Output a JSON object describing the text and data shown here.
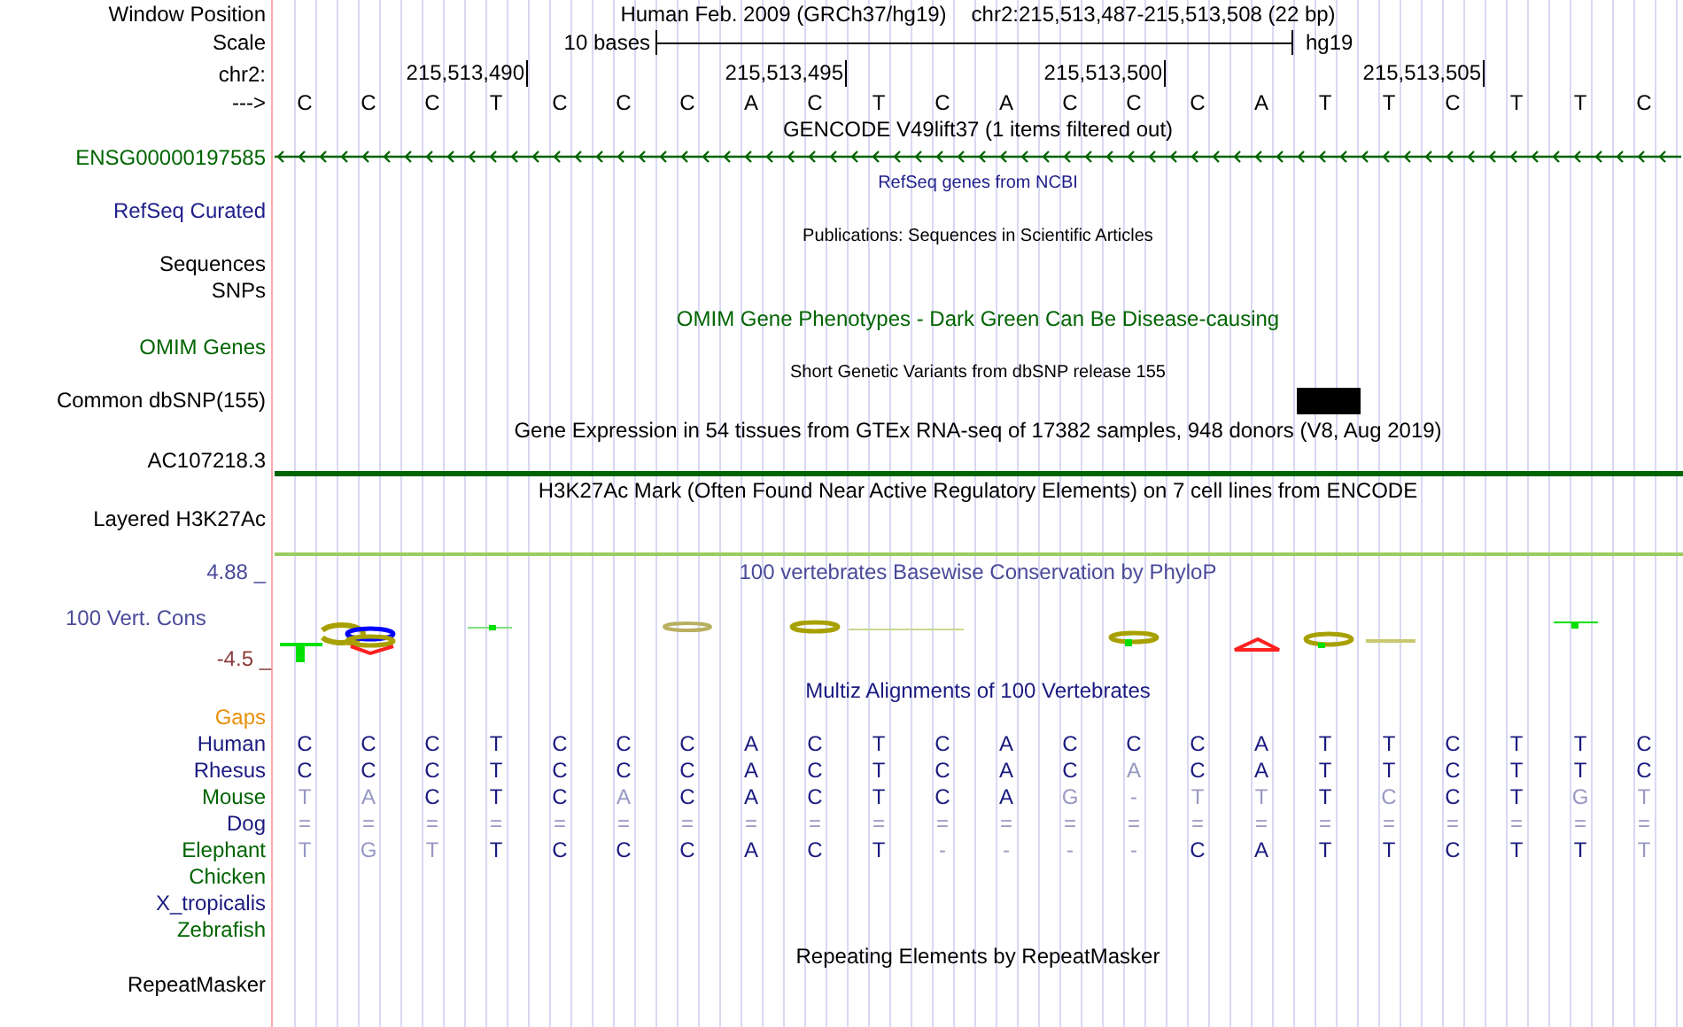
{
  "header": {
    "position_label": "Window Position",
    "assembly": "Human Feb. 2009 (GRCh37/hg19)",
    "position": "chr2:215,513,487-215,513,508 (22 bp)",
    "scale_label": "Scale",
    "scale_text": "10 bases",
    "scale_db": "hg19",
    "chrom_label": "chr2:",
    "ticks": [
      "215,513,490",
      "215,513,495",
      "215,513,500",
      "215,513,505"
    ],
    "strand_label": "--->",
    "bases": [
      "C",
      "C",
      "C",
      "T",
      "C",
      "C",
      "C",
      "A",
      "C",
      "T",
      "C",
      "A",
      "C",
      "C",
      "C",
      "A",
      "T",
      "T",
      "C",
      "T",
      "T",
      "C"
    ]
  },
  "tracks": [
    {
      "kind": "gene",
      "title": "GENCODE V49lift37 (1 items filtered out)",
      "labels": [
        "ENSG00000197585"
      ],
      "color": "#006400"
    },
    {
      "kind": "compact",
      "title": "RefSeq genes from NCBI",
      "labels": [
        "RefSeq Curated"
      ],
      "color": "#20208c"
    },
    {
      "kind": "compact",
      "title": "Publications: Sequences in Scientific Articles",
      "labels": [
        "Sequences",
        "SNPs"
      ],
      "color": "#000000"
    },
    {
      "kind": "plain",
      "title": "OMIM Gene Phenotypes - Dark Green Can Be Disease-causing",
      "labels": [
        "OMIM Genes"
      ],
      "color": "#006400"
    },
    {
      "kind": "snp",
      "title": "Short Genetic Variants from dbSNP release 155",
      "labels": [
        "Common dbSNP(155)"
      ],
      "color": "#000000"
    },
    {
      "kind": "bar",
      "title": "Gene Expression in 54 tissues from GTEx RNA-seq of 17382 samples, 948 donors (V8, Aug 2019)",
      "labels": [
        "AC107218.3"
      ],
      "color": "#000000"
    },
    {
      "kind": "plain",
      "title": "H3K27Ac Mark (Often Found Near Active Regulatory Elements) on 7 cell lines from ENCODE",
      "labels": [
        "Layered H3K27Ac"
      ],
      "color": "#000000"
    },
    {
      "kind": "wiggle",
      "title": "100 vertebrates Basewise Conservation by PhyloP",
      "labels": [
        "100 Vert. Cons"
      ],
      "axis_max": "4.88 _",
      "axis_min": "-4.5 _",
      "color": "#4a4a9a"
    },
    {
      "kind": "alignment",
      "title": "Multiz Alignments of 100 Vertebrates",
      "color": "#1a1a80",
      "species": [
        {
          "name": "Gaps",
          "color": "#e8900c"
        },
        {
          "name": "Human",
          "color": "#1a1a80",
          "bases": [
            "C",
            "C",
            "C",
            "T",
            "C",
            "C",
            "C",
            "A",
            "C",
            "T",
            "C",
            "A",
            "C",
            "C",
            "C",
            "A",
            "T",
            "T",
            "C",
            "T",
            "T",
            "C"
          ],
          "faint": [
            false,
            false,
            false,
            false,
            false,
            false,
            false,
            false,
            false,
            false,
            false,
            false,
            false,
            false,
            false,
            false,
            false,
            false,
            false,
            false,
            false,
            false
          ]
        },
        {
          "name": "Rhesus",
          "color": "#1a1a80",
          "bases": [
            "C",
            "C",
            "C",
            "T",
            "C",
            "C",
            "C",
            "A",
            "C",
            "T",
            "C",
            "A",
            "C",
            "A",
            "C",
            "A",
            "T",
            "T",
            "C",
            "T",
            "T",
            "C"
          ],
          "faint": [
            false,
            false,
            false,
            false,
            false,
            false,
            false,
            false,
            false,
            false,
            false,
            false,
            false,
            true,
            false,
            false,
            false,
            false,
            false,
            false,
            false,
            false
          ]
        },
        {
          "name": "Mouse",
          "color": "#006400",
          "bases": [
            "T",
            "A",
            "C",
            "T",
            "C",
            "A",
            "C",
            "A",
            "C",
            "T",
            "C",
            "A",
            "G",
            "-",
            "T",
            "T",
            "T",
            "C",
            "C",
            "T",
            "G",
            "T"
          ],
          "faint": [
            true,
            true,
            false,
            false,
            false,
            true,
            false,
            false,
            false,
            false,
            false,
            false,
            true,
            true,
            true,
            true,
            false,
            true,
            false,
            false,
            true,
            true
          ]
        },
        {
          "name": "Dog",
          "color": "#1a1a80",
          "bases": [
            "=",
            "=",
            "=",
            "=",
            "=",
            "=",
            "=",
            "=",
            "=",
            "=",
            "=",
            "=",
            "=",
            "=",
            "=",
            "=",
            "=",
            "=",
            "=",
            "=",
            "=",
            "="
          ],
          "faint": [
            true,
            true,
            true,
            true,
            true,
            true,
            true,
            true,
            true,
            true,
            true,
            true,
            true,
            true,
            true,
            true,
            true,
            true,
            true,
            true,
            true,
            true
          ]
        },
        {
          "name": "Elephant",
          "color": "#006400",
          "bases": [
            "T",
            "G",
            "T",
            "T",
            "C",
            "C",
            "C",
            "A",
            "C",
            "T",
            "-",
            "-",
            "-",
            "-",
            "C",
            "A",
            "T",
            "T",
            "C",
            "T",
            "T",
            "T"
          ],
          "faint": [
            true,
            true,
            true,
            false,
            false,
            false,
            false,
            false,
            false,
            false,
            true,
            true,
            true,
            true,
            false,
            false,
            false,
            false,
            false,
            false,
            false,
            true
          ]
        },
        {
          "name": "Chicken",
          "color": "#006400"
        },
        {
          "name": "X_tropicalis",
          "color": "#1a1a80"
        },
        {
          "name": "Zebrafish",
          "color": "#006400"
        }
      ]
    },
    {
      "kind": "plain",
      "title": "Repeating Elements by RepeatMasker",
      "labels": [
        "RepeatMasker"
      ],
      "color": "#000000"
    }
  ]
}
